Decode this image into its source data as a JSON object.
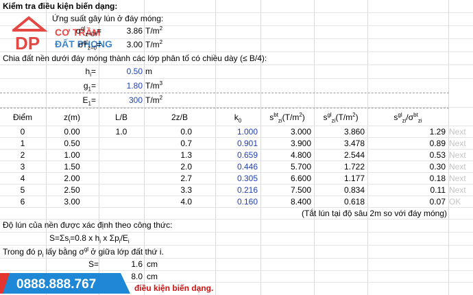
{
  "title": "Kiểm tra điều kiện biến dạng:",
  "stress_heading": "Ứng suất gây lún ở đáy móng:",
  "stress_rows": [
    {
      "label_pre": "σ",
      "label_sup": "gl",
      "label_sub": "z=Df",
      "label_post": "=",
      "value": "3.86",
      "unit": "T/m",
      "unit_sup": "2"
    },
    {
      "label_pre": "σ",
      "label_sup": "gl",
      "label_sub": "z=0",
      "label_post": "=",
      "value": "3.00",
      "unit": "T/m",
      "unit_sup": "2"
    }
  ],
  "split_text": "Chia đất nền dưới đáy móng thành các lớp phân tố có chiều dày (≤ B/4):",
  "params": [
    {
      "label_pre": "h",
      "label_sub": "i",
      "label_post": "=",
      "value": "0.50",
      "unit": "m",
      "unit_sup": ""
    },
    {
      "label_pre": "g",
      "label_sub": "1",
      "label_post": "=",
      "value": "1.80",
      "unit": "T/m",
      "unit_sup": "3"
    },
    {
      "label_pre": "E",
      "label_sub": "1",
      "label_post": "=",
      "value": "300",
      "unit": "T/m",
      "unit_sup": "2"
    }
  ],
  "table": {
    "headers": [
      "Điểm",
      "z(m)",
      "L/B",
      "2z/B",
      "k",
      "s",
      "s",
      "s"
    ],
    "header_subs": {
      "k0": "0",
      "sbt": "bt",
      "sbt_sub": "zi",
      "sgl": "gl",
      "sgl_sub": "zi"
    },
    "header_k": {
      "pre": "k",
      "sub": "0"
    },
    "header_sbt": {
      "pre": "s",
      "sup": "bt",
      "sub": "zi",
      "post": "(T/m",
      "post_sup": "2",
      "end": ")"
    },
    "header_sgl": {
      "pre": "s",
      "sup": "gl",
      "sub": "zi",
      "post": "(T/m",
      "post_sup": "2",
      "end": ")"
    },
    "header_ratio": {
      "pre": "s",
      "sup": "gl",
      "sub": "zi",
      "mid": "/σ",
      "sup2": "bt",
      "sub2": "zi"
    },
    "rows": [
      {
        "diem": "0",
        "z": "0.00",
        "lb": "1.0",
        "tzb": "0.0",
        "k0": "1.000",
        "sbt": "3.000",
        "sgl": "3.860",
        "ratio": "1.29",
        "status": "Next"
      },
      {
        "diem": "1",
        "z": "0.50",
        "lb": "",
        "tzb": "0.7",
        "k0": "0.901",
        "sbt": "3.900",
        "sgl": "3.478",
        "ratio": "0.89",
        "status": "Next"
      },
      {
        "diem": "2",
        "z": "1.00",
        "lb": "",
        "tzb": "1.3",
        "k0": "0.659",
        "sbt": "4.800",
        "sgl": "2.544",
        "ratio": "0.53",
        "status": "Next"
      },
      {
        "diem": "3",
        "z": "1.50",
        "lb": "",
        "tzb": "2.0",
        "k0": "0.446",
        "sbt": "5.700",
        "sgl": "1.722",
        "ratio": "0.30",
        "status": "Next"
      },
      {
        "diem": "4",
        "z": "2.00",
        "lb": "",
        "tzb": "2.7",
        "k0": "0.305",
        "sbt": "6.600",
        "sgl": "1.177",
        "ratio": "0.18",
        "status": "Next"
      },
      {
        "diem": "5",
        "z": "2.50",
        "lb": "",
        "tzb": "3.3",
        "k0": "0.216",
        "sbt": "7.500",
        "sgl": "0.834",
        "ratio": "0.11",
        "status": "Next"
      },
      {
        "diem": "6",
        "z": "3.00",
        "lb": "",
        "tzb": "4.0",
        "k0": "0.160",
        "sbt": "8.400",
        "sgl": "0.618",
        "ratio": "0.07",
        "status": "OK"
      }
    ],
    "note": "(Tắt lún tại độ sâu 2m so với đáy móng)"
  },
  "settlement_text": "Độ lún của nền được xác định theo công thức:",
  "formula": {
    "a": "S=Σs",
    "a_sub": "i",
    "b": "=0.8 x h",
    "b_sub": "i",
    "c": " x Σp",
    "c_sub": "i",
    "d": "/E",
    "d_sub": "i"
  },
  "where_text": {
    "a": "Trong đó p",
    "a_sub": "i",
    "b": " lấy bằng σ",
    "b_sup": "gl",
    "c": " ở giữa lớp đất thứ i."
  },
  "s_row": {
    "label": "S=",
    "value": "1.6",
    "unit": "cm"
  },
  "limit_row": {
    "value": "8.0",
    "unit": "cm"
  },
  "conclusion": "điều kiện biến dạng.",
  "logo": {
    "dp": "DP",
    "line1": "CƠ TRẦM",
    "line2": "ĐẤT PHONG"
  },
  "phone": "0888.888.767",
  "colors": {
    "blue_value": "#1f3fb8",
    "red_text": "#d01010",
    "gray_status": "#c4c4c4",
    "logo_red": "#e3342f",
    "logo_blue": "#2b78c5",
    "phone_bg": "#1e88d6"
  }
}
